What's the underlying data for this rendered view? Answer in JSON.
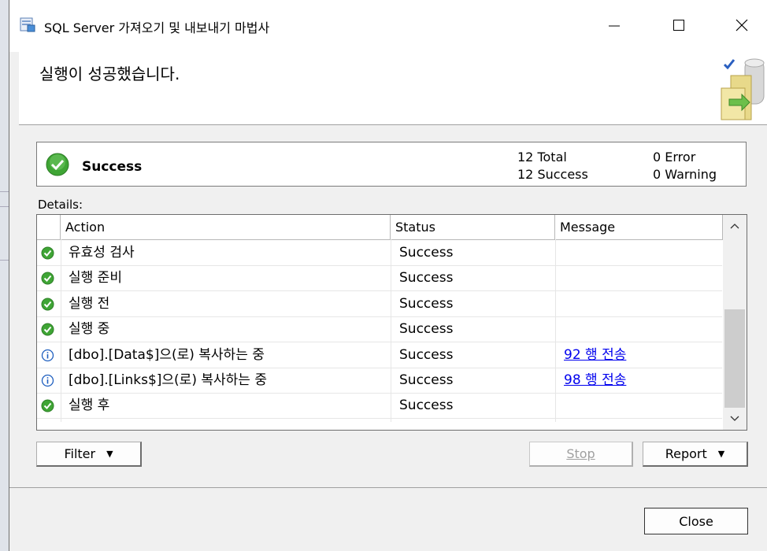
{
  "window": {
    "title": "SQL Server 가져오기 및 내보내기 마법사",
    "minimize_icon": "minimize-icon",
    "maximize_icon": "maximize-icon",
    "close_icon": "close-icon"
  },
  "header": {
    "title": "실행이 성공했습니다."
  },
  "summary": {
    "status": "Success",
    "total": "12 Total",
    "success": "12 Success",
    "error": "0 Error",
    "warning": "0 Warning"
  },
  "details": {
    "label": "Details:",
    "columns": [
      "Action",
      "Status",
      "Message"
    ],
    "rows": [
      {
        "icon": "success-check-icon",
        "action": "유효성 검사",
        "status": "Success",
        "message": ""
      },
      {
        "icon": "success-check-icon",
        "action": "실행 준비",
        "status": "Success",
        "message": ""
      },
      {
        "icon": "success-check-icon",
        "action": "실행 전",
        "status": "Success",
        "message": ""
      },
      {
        "icon": "success-check-icon",
        "action": "실행 중",
        "status": "Success",
        "message": ""
      },
      {
        "icon": "info-icon",
        "action": "[dbo].[Data$]으(로) 복사하는 중",
        "status": "Success",
        "message": "92 행 전송"
      },
      {
        "icon": "info-icon",
        "action": "[dbo].[Links$]으(로) 복사하는 중",
        "status": "Success",
        "message": "98 행 전송"
      },
      {
        "icon": "success-check-icon",
        "action": "실행 후",
        "status": "Success",
        "message": ""
      }
    ]
  },
  "buttons": {
    "filter": "Filter",
    "stop": "Stop",
    "report": "Report",
    "close": "Close"
  },
  "colors": {
    "success_green": "#3fa535",
    "info_blue": "#1f5fbf",
    "link_blue": "#0000ee"
  }
}
